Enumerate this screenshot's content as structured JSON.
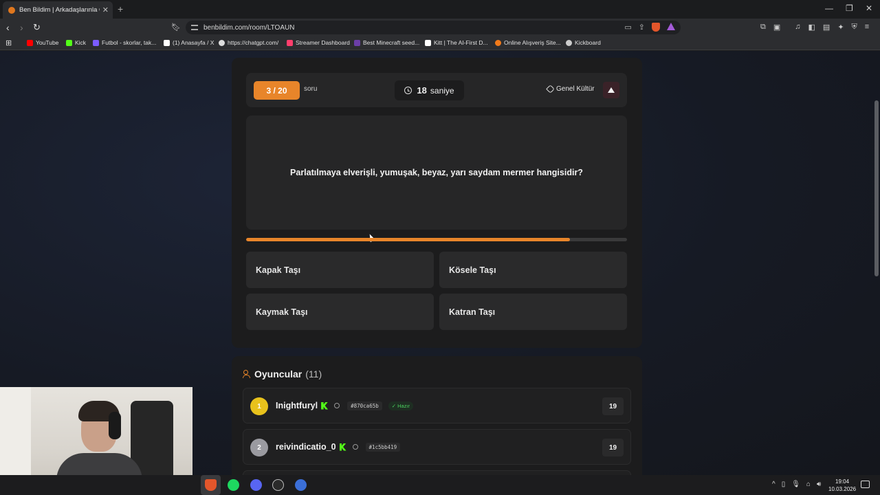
{
  "browser": {
    "tab_title": "Ben Bildim | Arkadaşlarınla Onlin",
    "url": "benbildim.com/room/LTOAUN",
    "bookmarks": [
      {
        "label": "YouTube",
        "color": "#ff0000"
      },
      {
        "label": "Kick",
        "color": "#53fc18"
      },
      {
        "label": "Futbol - skorlar, tak...",
        "color": "#7b5cff"
      },
      {
        "label": "(1) Anasayfa / X",
        "color": "#ffffff"
      },
      {
        "label": "https://chatgpt.com/",
        "color": "#dddddd"
      },
      {
        "label": "Streamer Dashboard",
        "color": "#ff3e6c"
      },
      {
        "label": "Best Minecraft seed...",
        "color": "#6b3ea8"
      },
      {
        "label": "Kitt | The AI-First D...",
        "color": "#ffffff"
      },
      {
        "label": "Online Alışveriş Site...",
        "color": "#f27a1a"
      },
      {
        "label": "Kickboard",
        "color": "#cccccc"
      }
    ]
  },
  "game": {
    "counter": "3 / 20",
    "counter_suffix": "soru",
    "timer_value": "18",
    "timer_unit": "saniye",
    "category": "Genel Kültür",
    "question": "Parlatılmaya elverişli, yumuşak, beyaz, yarı saydam mermer hangisidir?",
    "progress_fraction": 0.85,
    "answers": [
      "Kapak Taşı",
      "Kösele Taşı",
      "Kaymak Taşı",
      "Katran Taşı"
    ]
  },
  "players": {
    "title": "Oyuncular",
    "count": "(11)",
    "list": [
      {
        "rank": "1",
        "name": "Inightfuryl",
        "id": "#870ca65b",
        "status": "Hazır",
        "score": "19",
        "rank_color": "#e8c21c"
      },
      {
        "rank": "2",
        "name": "reivindicatio_0",
        "id": "#1c5bb419",
        "status": "",
        "score": "19",
        "rank_color": "#9a9aa0"
      }
    ]
  },
  "taskbar": {
    "time": "19:04",
    "date": "10.03.2026"
  },
  "colors": {
    "accent": "#e8852a",
    "kick_green": "#53fc18",
    "ready_green": "#4bd15f"
  }
}
